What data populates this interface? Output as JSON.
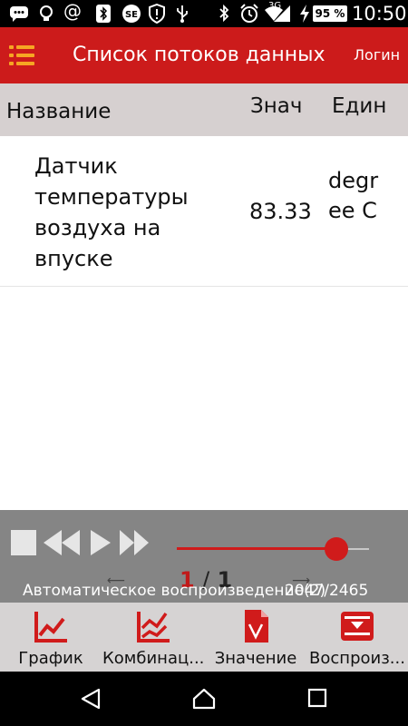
{
  "status_bar": {
    "icons": [
      "chat-icon",
      "lightbulb-icon",
      "at-icon",
      "bluetooth-icon",
      "se-icon",
      "shield-icon",
      "usb-icon",
      "bluetooth-icon",
      "alarm-icon",
      "wifi-icon",
      "signal-icon",
      "charging-icon"
    ],
    "network": "3G",
    "battery": "95 %",
    "time": "10:50"
  },
  "app_bar": {
    "title": "Список потоков данных",
    "login": "Логин",
    "accent_color": "#cc1b1b",
    "menu_icon_color": "#f6a623"
  },
  "table": {
    "headers": {
      "name": "Название",
      "value": "Знач",
      "unit": "Един"
    },
    "rows": [
      {
        "name": "Датчик температуры воздуха на впуске",
        "value": "83.33",
        "unit": "degree C"
      }
    ]
  },
  "player": {
    "progress_fraction": 0.83,
    "page_current": "1",
    "page_separator": "/",
    "page_total": "1",
    "auto_play_label": "Автоматическое воспроизведение(2)",
    "counter": "2047/2465"
  },
  "toolbar": {
    "items": [
      {
        "label": "График",
        "icon": "line-chart-icon"
      },
      {
        "label": "Комбинац...",
        "icon": "combined-chart-icon"
      },
      {
        "label": "Значение",
        "icon": "value-document-icon"
      },
      {
        "label": "Воспроиз...",
        "icon": "playback-icon"
      }
    ],
    "icon_color": "#d01b1b"
  },
  "nav_bar": {
    "icons": [
      "back-icon",
      "home-icon",
      "recents-icon"
    ]
  }
}
